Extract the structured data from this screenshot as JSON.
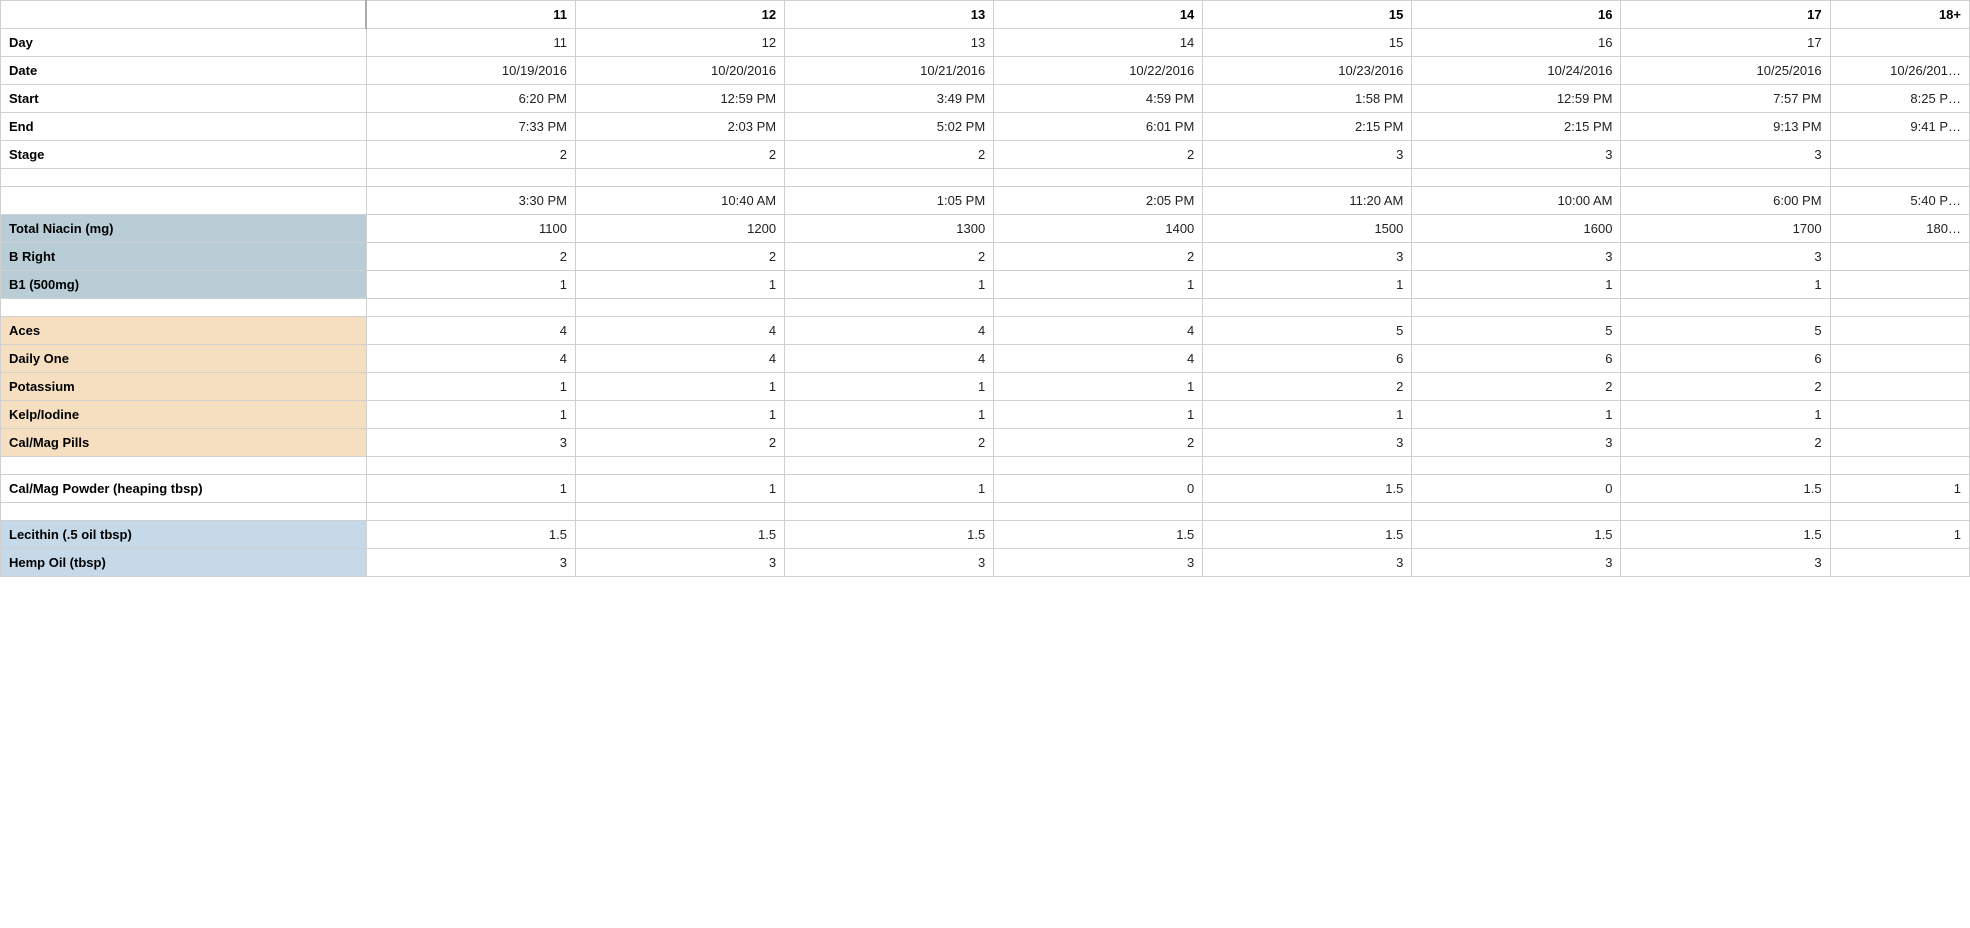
{
  "columns": {
    "label": "",
    "days": [
      "11",
      "12",
      "13",
      "14",
      "15",
      "16",
      "17",
      "18+"
    ]
  },
  "rows": [
    {
      "id": "day",
      "label": "Day",
      "labelStyle": "plain",
      "bold": true,
      "values": [
        "11",
        "12",
        "13",
        "14",
        "15",
        "16",
        "17",
        ""
      ]
    },
    {
      "id": "date",
      "label": "Date",
      "labelStyle": "plain",
      "bold": true,
      "values": [
        "10/19/2016",
        "10/20/2016",
        "10/21/2016",
        "10/22/2016",
        "10/23/2016",
        "10/24/2016",
        "10/25/2016",
        "10/26/201…"
      ]
    },
    {
      "id": "start",
      "label": "Start",
      "labelStyle": "plain",
      "bold": true,
      "values": [
        "6:20 PM",
        "12:59 PM",
        "3:49 PM",
        "4:59 PM",
        "1:58 PM",
        "12:59 PM",
        "7:57 PM",
        "8:25 P…"
      ]
    },
    {
      "id": "end",
      "label": "End",
      "labelStyle": "plain",
      "bold": true,
      "values": [
        "7:33 PM",
        "2:03 PM",
        "5:02 PM",
        "6:01 PM",
        "2:15 PM",
        "2:15 PM",
        "9:13 PM",
        "9:41 P…"
      ]
    },
    {
      "id": "stage",
      "label": "Stage",
      "labelStyle": "plain",
      "bold": true,
      "values": [
        "2",
        "2",
        "2",
        "2",
        "3",
        "3",
        "3",
        ""
      ]
    },
    {
      "id": "empty1",
      "label": "",
      "labelStyle": "white",
      "bold": false,
      "values": [
        "",
        "",
        "",
        "",
        "",
        "",
        "",
        ""
      ]
    },
    {
      "id": "time2",
      "label": "",
      "labelStyle": "white",
      "bold": false,
      "values": [
        "3:30 PM",
        "10:40 AM",
        "1:05 PM",
        "2:05 PM",
        "11:20 AM",
        "10:00 AM",
        "6:00 PM",
        "5:40 P…"
      ]
    },
    {
      "id": "total_niacin",
      "label": "Total Niacin (mg)",
      "labelStyle": "blue",
      "bold": true,
      "values": [
        "1100",
        "1200",
        "1300",
        "1400",
        "1500",
        "1600",
        "1700",
        "180…"
      ]
    },
    {
      "id": "b_right",
      "label": "B Right",
      "labelStyle": "blue",
      "bold": true,
      "values": [
        "2",
        "2",
        "2",
        "2",
        "3",
        "3",
        "3",
        ""
      ]
    },
    {
      "id": "b1",
      "label": "B1 (500mg)",
      "labelStyle": "blue",
      "bold": true,
      "values": [
        "1",
        "1",
        "1",
        "1",
        "1",
        "1",
        "1",
        ""
      ]
    },
    {
      "id": "empty2",
      "label": "",
      "labelStyle": "white",
      "bold": false,
      "values": [
        "",
        "",
        "",
        "",
        "",
        "",
        "",
        ""
      ]
    },
    {
      "id": "aces",
      "label": "Aces",
      "labelStyle": "peach",
      "bold": true,
      "values": [
        "4",
        "4",
        "4",
        "4",
        "5",
        "5",
        "5",
        ""
      ]
    },
    {
      "id": "daily_one",
      "label": "Daily One",
      "labelStyle": "peach",
      "bold": true,
      "values": [
        "4",
        "4",
        "4",
        "4",
        "6",
        "6",
        "6",
        ""
      ]
    },
    {
      "id": "potassium",
      "label": "Potassium",
      "labelStyle": "peach",
      "bold": true,
      "values": [
        "1",
        "1",
        "1",
        "1",
        "2",
        "2",
        "2",
        ""
      ]
    },
    {
      "id": "kelp",
      "label": "Kelp/Iodine",
      "labelStyle": "peach",
      "bold": true,
      "values": [
        "1",
        "1",
        "1",
        "1",
        "1",
        "1",
        "1",
        ""
      ]
    },
    {
      "id": "calmag_pills",
      "label": "Cal/Mag Pills",
      "labelStyle": "peach",
      "bold": true,
      "values": [
        "3",
        "2",
        "2",
        "2",
        "3",
        "3",
        "2",
        ""
      ]
    },
    {
      "id": "empty3",
      "label": "",
      "labelStyle": "white",
      "bold": false,
      "values": [
        "",
        "",
        "",
        "",
        "",
        "",
        "",
        ""
      ]
    },
    {
      "id": "calmag_powder",
      "label": "Cal/Mag Powder (heaping tbsp)",
      "labelStyle": "white",
      "bold": true,
      "values": [
        "1",
        "1",
        "1",
        "0",
        "1.5",
        "0",
        "1.5",
        "1"
      ]
    },
    {
      "id": "empty4",
      "label": "",
      "labelStyle": "white",
      "bold": false,
      "values": [
        "",
        "",
        "",
        "",
        "",
        "",
        "",
        ""
      ]
    },
    {
      "id": "lecithin",
      "label": "Lecithin (.5 oil tbsp)",
      "labelStyle": "light-blue",
      "bold": true,
      "values": [
        "1.5",
        "1.5",
        "1.5",
        "1.5",
        "1.5",
        "1.5",
        "1.5",
        "1"
      ]
    },
    {
      "id": "hemp_oil",
      "label": "Hemp Oil (tbsp)",
      "labelStyle": "light-blue",
      "bold": true,
      "values": [
        "3",
        "3",
        "3",
        "3",
        "3",
        "3",
        "3",
        ""
      ]
    }
  ]
}
